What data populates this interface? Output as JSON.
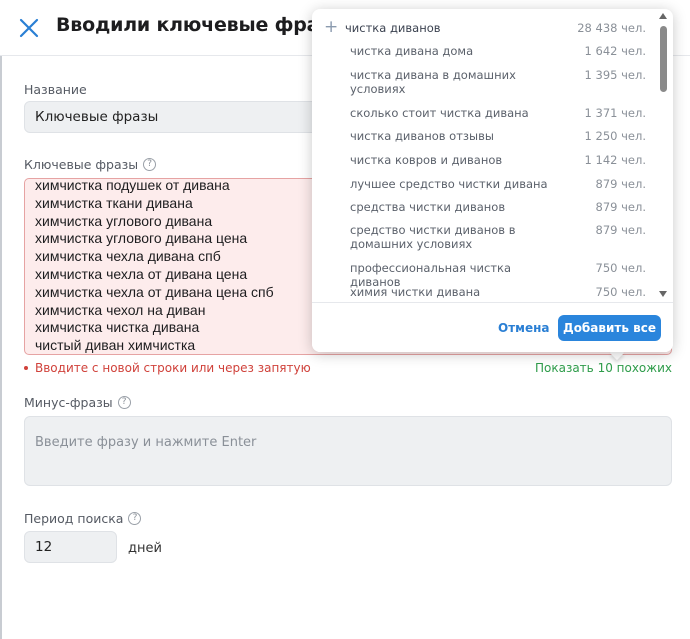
{
  "header": {
    "title": "Вводили ключевые фразы"
  },
  "form": {
    "name_label": "Название",
    "name_value": "Ключевые фразы",
    "keywords_label": "Ключевые фразы",
    "keywords": [
      "химчистка подушек от дивана",
      "химчистка ткани дивана",
      "химчистка углового дивана",
      "химчистка углового дивана цена",
      "химчистка чехла дивана спб",
      "химчистка чехла от дивана цена",
      "химчистка чехла от дивана цена спб",
      "химчистка чехол на диван",
      "химчистка чистка дивана",
      "чистый диван химчистка"
    ],
    "keywords_error": "Вводите с новой строки или через запятую",
    "show_similar": "Показать 10 похожих",
    "minus_label": "Минус-фразы",
    "minus_placeholder": "Введите фразу и нажмите Enter",
    "period_label": "Период поиска",
    "period_value": "12",
    "period_unit": "дней"
  },
  "popup": {
    "suggestions": [
      {
        "text": "чистка диванов",
        "count": "28 438 чел."
      },
      {
        "text": "чистка дивана дома",
        "count": "1 642 чел."
      },
      {
        "text": "чистка дивана в домашних условиях",
        "count": "1 395 чел."
      },
      {
        "text": "сколько стоит чистка дивана",
        "count": "1 371 чел."
      },
      {
        "text": "чистка диванов отзывы",
        "count": "1 250 чел."
      },
      {
        "text": "чистка ковров и диванов",
        "count": "1 142 чел."
      },
      {
        "text": "лучшее средство чистки дивана",
        "count": "879 чел."
      },
      {
        "text": "средства чистки диванов",
        "count": "879 чел."
      },
      {
        "text": "средство чистки диванов в домашних условиях",
        "count": "879 чел."
      },
      {
        "text": "профессиональная чистка диванов",
        "count": "750 чел."
      },
      {
        "text": "химия чистки дивана",
        "count": "750 чел."
      }
    ],
    "cancel_label": "Отмена",
    "add_all_label": "Добавить все"
  }
}
